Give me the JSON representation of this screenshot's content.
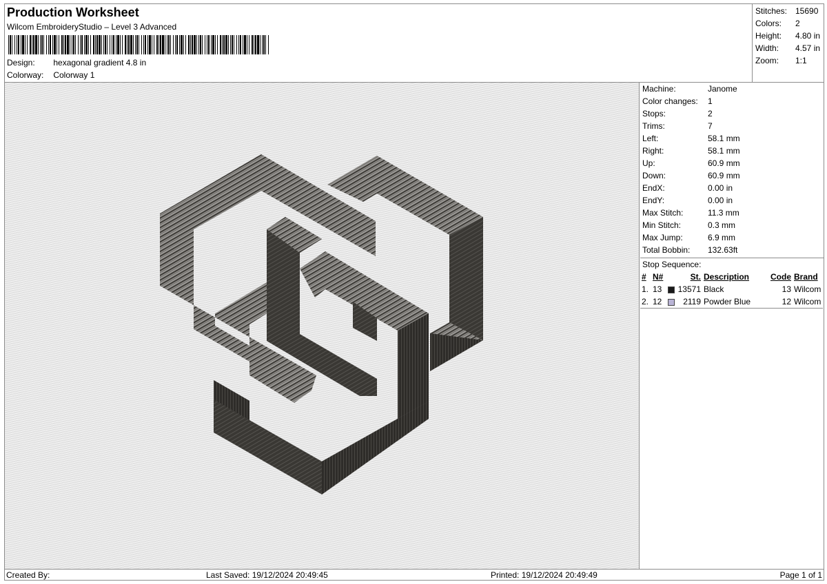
{
  "header": {
    "title": "Production Worksheet",
    "software": "Wilcom EmbroideryStudio – Level 3 Advanced",
    "design_label": "Design:",
    "design_value": "hexagonal gradient 4.8 in",
    "colorway_label": "Colorway:",
    "colorway_value": "Colorway 1"
  },
  "summary": [
    {
      "label": "Stitches:",
      "value": "15690"
    },
    {
      "label": "Colors:",
      "value": "2"
    },
    {
      "label": "Height:",
      "value": "4.80 in"
    },
    {
      "label": "Width:",
      "value": "4.57 in"
    },
    {
      "label": "Zoom:",
      "value": "1:1"
    }
  ],
  "machine_info": [
    {
      "label": "Machine:",
      "value": "Janome"
    },
    {
      "label": "Color changes:",
      "value": "1"
    },
    {
      "label": "Stops:",
      "value": "2"
    },
    {
      "label": "Trims:",
      "value": "7"
    },
    {
      "label": "Left:",
      "value": "58.1 mm"
    },
    {
      "label": "Right:",
      "value": "58.1 mm"
    },
    {
      "label": "Up:",
      "value": "60.9 mm"
    },
    {
      "label": "Down:",
      "value": "60.9 mm"
    },
    {
      "label": "EndX:",
      "value": "0.00 in"
    },
    {
      "label": "EndY:",
      "value": "0.00 in"
    },
    {
      "label": "Max Stitch:",
      "value": "11.3 mm"
    },
    {
      "label": "Min Stitch:",
      "value": "0.3 mm"
    },
    {
      "label": "Max Jump:",
      "value": "6.9 mm"
    },
    {
      "label": "Total Bobbin:",
      "value": "132.63ft"
    }
  ],
  "stop_sequence": {
    "title": "Stop Sequence:",
    "columns": [
      "#",
      "N#",
      "St.",
      "Description",
      "Code",
      "Brand"
    ],
    "rows": [
      {
        "index": "1.",
        "n": "13",
        "color": "#1a1a1a",
        "stitches": "13571",
        "description": "Black",
        "code": "13",
        "brand": "Wilcom"
      },
      {
        "index": "2.",
        "n": "12",
        "color": "#b9b4d6",
        "stitches": "2119",
        "description": "Powder Blue",
        "code": "12",
        "brand": "Wilcom"
      }
    ]
  },
  "footer": {
    "created_by": "Created By:",
    "last_saved": "Last Saved: 19/12/2024 20:49:45",
    "printed": "Printed: 19/12/2024 20:49:49",
    "page": "Page 1 of 1"
  },
  "colors": {
    "border": "#8c8c8c",
    "canvas_bg": "#e9e9e9",
    "thread_dark": "#3b3935",
    "thread_mid": "#5e5c58"
  }
}
